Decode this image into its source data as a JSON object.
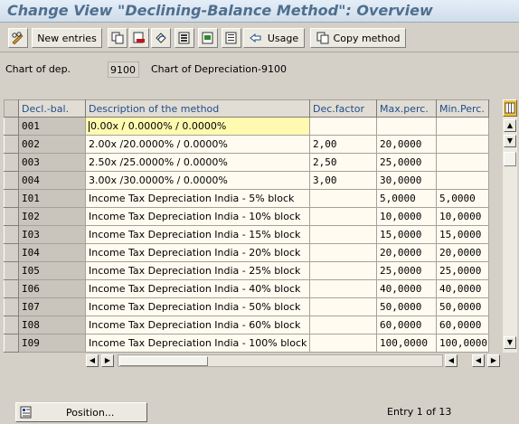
{
  "window": {
    "title": "Change View \"Declining-Balance Method\": Overview"
  },
  "toolbar": {
    "new_entries": "New entries",
    "usage": "Usage",
    "copy_method": "Copy method",
    "icons": [
      "edit-glasses-icon",
      "copy-icon",
      "delete-icon",
      "undo-icon",
      "select-all-icon",
      "select-block-icon",
      "deselect-icon",
      "usage-icon",
      "copy-method-icon"
    ]
  },
  "header": {
    "chart_label": "Chart of dep.",
    "chart_value": "9100",
    "chart_desc": "Chart of Depreciation-9100"
  },
  "table": {
    "columns": [
      "Decl.-bal.",
      "Description of the method",
      "Dec.factor",
      "Max.perc.",
      "Min.Perc."
    ],
    "rows": [
      [
        "001",
        "0.00x / 0.0000% / 0.0000%",
        "",
        "",
        ""
      ],
      [
        "002",
        "2.00x /20.0000% / 0.0000%",
        "2,00",
        "20,0000",
        ""
      ],
      [
        "003",
        "2.50x /25.0000% / 0.0000%",
        "2,50",
        "25,0000",
        ""
      ],
      [
        "004",
        "3.00x /30.0000% / 0.0000%",
        "3,00",
        "30,0000",
        ""
      ],
      [
        "I01",
        "Income Tax Depreciation India - 5% block",
        "",
        "5,0000",
        "5,0000"
      ],
      [
        "I02",
        "Income Tax Depreciation India - 10% block",
        "",
        "10,0000",
        "10,0000"
      ],
      [
        "I03",
        "Income Tax Depreciation India - 15% block",
        "",
        "15,0000",
        "15,0000"
      ],
      [
        "I04",
        "Income Tax Depreciation India - 20% block",
        "",
        "20,0000",
        "20,0000"
      ],
      [
        "I05",
        "Income Tax Depreciation India - 25% block",
        "",
        "25,0000",
        "25,0000"
      ],
      [
        "I06",
        "Income Tax Depreciation India - 40% block",
        "",
        "40,0000",
        "40,0000"
      ],
      [
        "I07",
        "Income Tax Depreciation India - 50% block",
        "",
        "50,0000",
        "50,0000"
      ],
      [
        "I08",
        "Income Tax Depreciation India - 60% block",
        "",
        "60,0000",
        "60,0000"
      ],
      [
        "I09",
        "Income Tax Depreciation India - 100% block",
        "",
        "100,0000",
        "100,0000"
      ]
    ]
  },
  "footer": {
    "position_label": "Position...",
    "entry_info": "Entry 1 of 13"
  },
  "colors": {
    "title": "#4f6f8e",
    "header_text": "#1f4d8c",
    "focus_cell": "#fffab0",
    "config_button": "#f0c23a"
  }
}
